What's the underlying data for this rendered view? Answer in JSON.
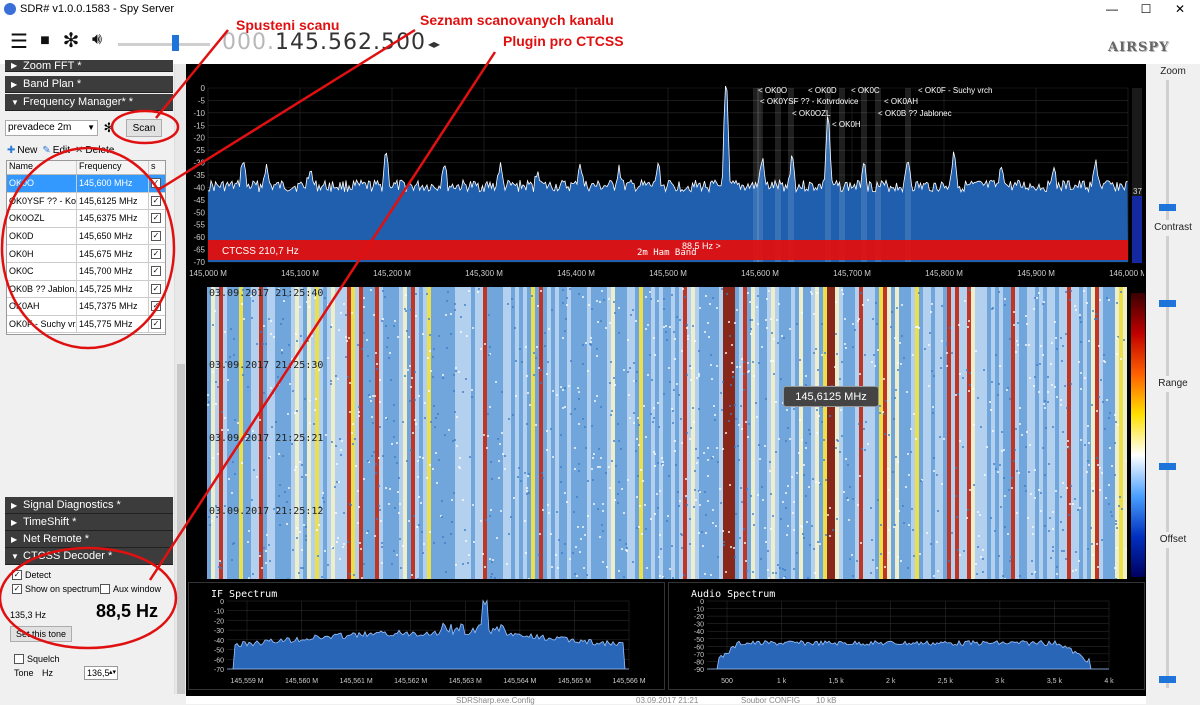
{
  "window": {
    "title": "SDR# v1.0.0.1583 - Spy Server",
    "minimize": "—",
    "maximize": "☐",
    "close": "✕"
  },
  "toolbar": {
    "freq_dim": "000.",
    "freq_main": "145.562.500",
    "freq_arrows": "◂▸",
    "logo": "AIRSPY"
  },
  "sections": {
    "zoom_fft": "Zoom FFT *",
    "band_plan": "Band Plan *",
    "frequency_manager": "Frequency Manager* *",
    "signal_diagnostics": "Signal Diagnostics *",
    "timeshift": "TimeShift *",
    "net_remote": "Net Remote *",
    "ctcss_decoder": "CTCSS Decoder *"
  },
  "freq_manager": {
    "group": "prevadece 2m",
    "scan_label": "Scan",
    "new_label": "New",
    "edit_label": "Edit",
    "delete_label": "Delete",
    "columns": [
      "Name",
      "Frequency",
      "s"
    ],
    "rows": [
      {
        "name": "OK0O",
        "freq": "145,600 MHz"
      },
      {
        "name": "OK0YSF ?? - Ko...",
        "freq": "145,6125 MHz"
      },
      {
        "name": "OK0OZL",
        "freq": "145,6375 MHz"
      },
      {
        "name": "OK0D",
        "freq": "145,650 MHz"
      },
      {
        "name": "OK0H",
        "freq": "145,675 MHz"
      },
      {
        "name": "OK0C",
        "freq": "145,700 MHz"
      },
      {
        "name": "OK0B ?? Jablon...",
        "freq": "145,725 MHz"
      },
      {
        "name": "OK0AH",
        "freq": "145,7375 MHz"
      },
      {
        "name": "OK0F - Suchy vr...",
        "freq": "145,775 MHz"
      }
    ]
  },
  "ctcss": {
    "detect": "Detect",
    "show_on_spectrum": "Show on spectrum",
    "aux_window": "Aux window",
    "small_freq": "135,3 Hz",
    "big_freq": "88,5 Hz",
    "set_tone": "Set this tone",
    "squelch": "Squelch",
    "tone_label": "Tone",
    "hz_label": "Hz",
    "tone_value": "136,5"
  },
  "spectrum": {
    "db_ticks": [
      "0",
      "-5",
      "-10",
      "-15",
      "-20",
      "-25",
      "-30",
      "-35",
      "-40",
      "-45",
      "-50",
      "-55",
      "-60",
      "-65",
      "-70"
    ],
    "freq_ticks": [
      "145,000 M",
      "145,100 M",
      "145,200 M",
      "145,300 M",
      "145,400 M",
      "145,500 M",
      "145,600 M",
      "145,700 M",
      "145,800 M",
      "145,900 M",
      "146,000 M"
    ],
    "ctcss_overlay": "CTCSS  210,7 Hz",
    "band_label": "2m Ham Band",
    "center_tone": "88,5 Hz >",
    "level_value": "37",
    "markers": [
      {
        "text": "< OK0O"
      },
      {
        "text": "< OK0D"
      },
      {
        "text": "< OK0C"
      },
      {
        "text": "< OK0F - Suchy vrch"
      },
      {
        "text": "< OK0YSF ?? - Kotvrdovice"
      },
      {
        "text": "< OK0AH"
      },
      {
        "text": "< OK0OZL"
      },
      {
        "text": "< OK0B ?? Jablonec"
      },
      {
        "text": "< OK0H"
      }
    ]
  },
  "waterfall": {
    "timestamps": [
      "03.09.2017 21:25:40",
      "03.09.2017 21:25:30",
      "03.09.2017 21:25:21",
      "03.09.2017 21:25:12"
    ],
    "tooltip": "145,6125 MHz"
  },
  "if_spectrum": {
    "title": "IF Spectrum",
    "db_ticks": [
      "0",
      "-10",
      "-20",
      "-30",
      "-40",
      "-50",
      "-60",
      "-70"
    ],
    "freq_ticks": [
      "145,559 M",
      "145,560 M",
      "145,561 M",
      "145,562 M",
      "145,563 M",
      "145,564 M",
      "145,565 M",
      "145,566 M"
    ]
  },
  "audio_spectrum": {
    "title": "Audio Spectrum",
    "db_ticks": [
      "0",
      "-10",
      "-20",
      "-30",
      "-40",
      "-50",
      "-60",
      "-70",
      "-80",
      "-90"
    ],
    "freq_ticks": [
      "500",
      "1 k",
      "1,5 k",
      "2 k",
      "2,5 k",
      "3 k",
      "3,5 k",
      "4 k"
    ]
  },
  "right_panel": {
    "zoom": "Zoom",
    "contrast": "Contrast",
    "range": "Range",
    "offset": "Offset"
  },
  "annotations": {
    "scan_start": "Spusteni scanu",
    "channel_list": "Seznam scanovanych kanalu",
    "ctcss_plugin": "Plugin pro CTCSS"
  },
  "taskbar_peek": {
    "file": "SDRSharp.exe.Config",
    "date": "03.09.2017 21:21",
    "type": "Soubor CONFIG",
    "size": "10 kB"
  },
  "colors": {
    "accent": "#1e74d8",
    "spectrum_fill": "#1f5fae",
    "band_red": "#e01010",
    "annotation_red": "#e01010"
  }
}
